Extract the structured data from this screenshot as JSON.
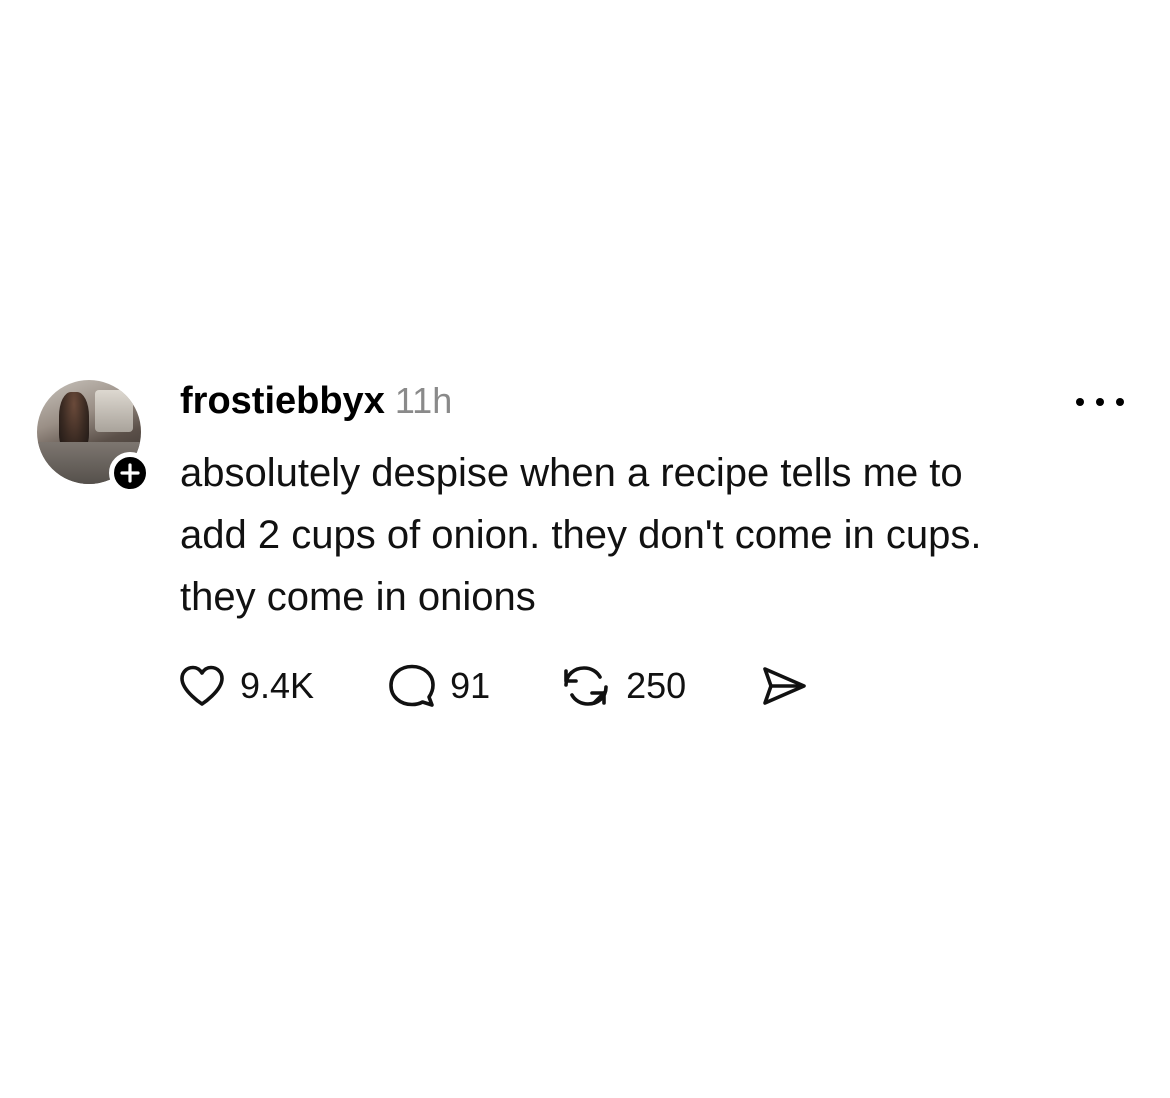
{
  "post": {
    "username": "frostiebbyx",
    "timestamp": "11h",
    "text_lines": [
      "absolutely despise when a recipe tells me to",
      "add 2 cups of onion. they don't come in cups.",
      "they come in onions"
    ],
    "avatar": {
      "icon": "profile-photo"
    },
    "follow_badge": {
      "icon": "plus-icon"
    },
    "more_menu": {
      "icon": "ellipsis-icon"
    }
  },
  "actions": {
    "like": {
      "icon": "heart-icon",
      "count": "9.4K"
    },
    "reply": {
      "icon": "speech-bubble-icon",
      "count": "91"
    },
    "repost": {
      "icon": "repost-arrows-icon",
      "count": "250"
    },
    "share": {
      "icon": "send-icon"
    }
  },
  "colors": {
    "background": "#ffffff",
    "text": "#000000",
    "secondary_text": "#8a8a8a"
  }
}
